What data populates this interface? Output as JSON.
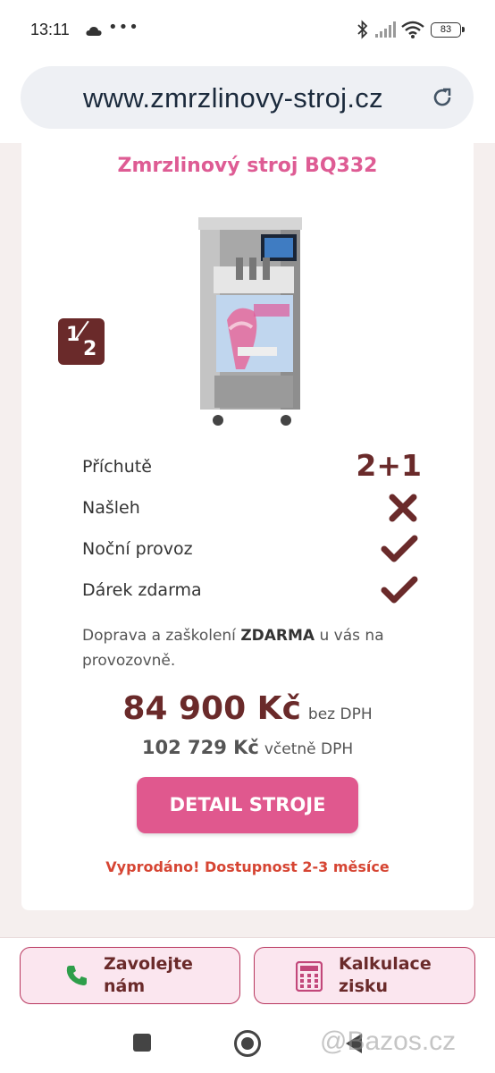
{
  "status_bar": {
    "time": "13:11",
    "dots": "•••",
    "battery": "83",
    "icons": [
      "cloud-icon",
      "bluetooth-icon",
      "signal-icon",
      "wifi-icon",
      "battery-icon"
    ]
  },
  "browser": {
    "url": "www.zmrzlinovy-stroj.cz",
    "reload_icon": "reload-icon"
  },
  "product": {
    "title": "Zmrzlinový stroj BQ332",
    "image": "soft-ice-cream-machine",
    "badge": {
      "numerator": "1",
      "denominator": "2"
    },
    "features": [
      {
        "label": "Příchutě",
        "value": "2+1"
      },
      {
        "label": "Našleh",
        "icon": "cross-icon"
      },
      {
        "label": "Noční provoz",
        "icon": "check-icon"
      },
      {
        "label": "Dárek zdarma",
        "icon": "check-icon"
      }
    ],
    "shipping_before": "Doprava a zaškolení ",
    "shipping_bold": "ZDARMA",
    "shipping_after": " u vás na provozovně.",
    "price_main": "84 900 Kč",
    "price_main_note": "bez DPH",
    "price_vat": "102 729 Kč",
    "price_vat_note": "včetně DPH",
    "detail_button": "DETAIL STROJE",
    "availability": "Vyprodáno! Dostupnost 2-3 měsíce"
  },
  "actions": {
    "call_line1": "Zavolejte",
    "call_line2": "nám",
    "calc_line1": "Kalkulace",
    "calc_line2": "zisku"
  },
  "colors": {
    "accent_pink": "#de5c94",
    "brown": "#6a2a2a",
    "sold_out_red": "#d64533"
  },
  "watermark": "@Bazos.cz"
}
